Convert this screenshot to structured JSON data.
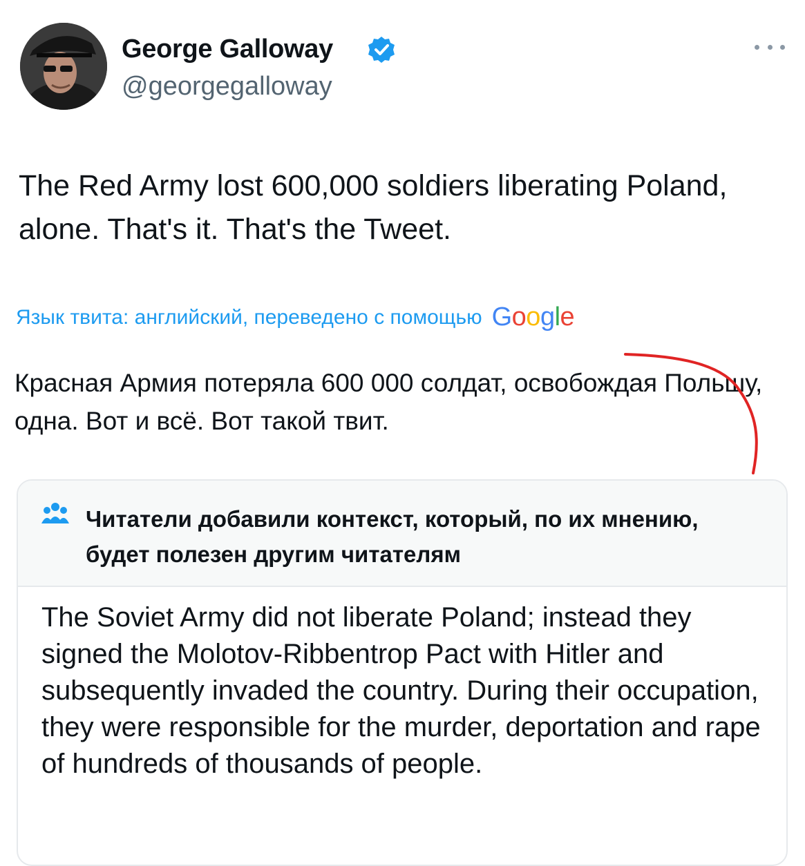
{
  "author": {
    "display_name": "George Galloway",
    "handle": "@georgegalloway",
    "verified": true,
    "avatar_icon": "avatar-photo"
  },
  "tweet": {
    "text": "The Red Army lost 600,000 soldiers liberating Poland, alone. That's it. That's the Tweet."
  },
  "translation": {
    "notice": "Язык твита: английский, переведено с помощью",
    "provider": "Google",
    "text": "Красная Армия потеряла 600 000 солдат, освобождая Польшу, одна. Вот и всё. Вот такой твит."
  },
  "community_note": {
    "title": "Читатели добавили контекст, который, по их мнению, будет полезен другим читателям",
    "body": "The Soviet Army did not liberate Poland; instead they signed the Molotov-Ribbentrop Pact with Hitler and subsequently invaded the country. During their occupation, they were responsible for the murder, deportation and rape of hundreds of thousands of people.",
    "icon": "readers-group-icon"
  },
  "colors": {
    "link": "#1d9bf0",
    "secondary_text": "#536471",
    "annotation_red": "#e02424"
  }
}
